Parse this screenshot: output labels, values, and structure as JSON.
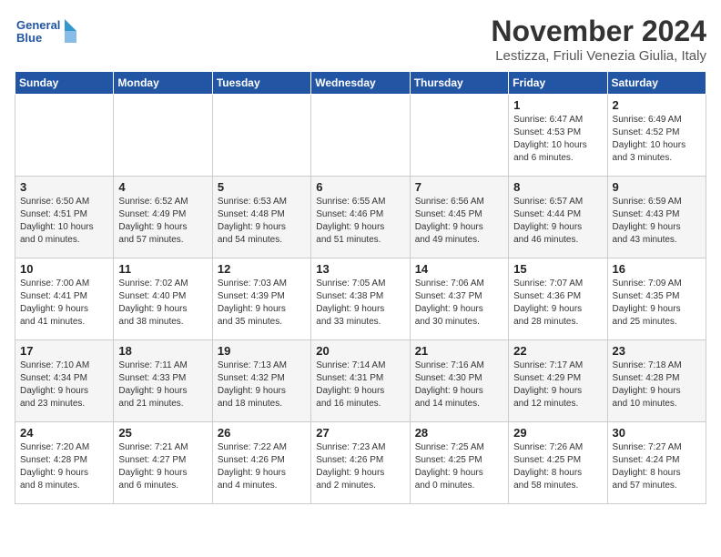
{
  "logo": {
    "text_general": "General",
    "text_blue": "Blue"
  },
  "header": {
    "month": "November 2024",
    "location": "Lestizza, Friuli Venezia Giulia, Italy"
  },
  "weekdays": [
    "Sunday",
    "Monday",
    "Tuesday",
    "Wednesday",
    "Thursday",
    "Friday",
    "Saturday"
  ],
  "weeks": [
    [
      {
        "day": "",
        "info": ""
      },
      {
        "day": "",
        "info": ""
      },
      {
        "day": "",
        "info": ""
      },
      {
        "day": "",
        "info": ""
      },
      {
        "day": "",
        "info": ""
      },
      {
        "day": "1",
        "info": "Sunrise: 6:47 AM\nSunset: 4:53 PM\nDaylight: 10 hours\nand 6 minutes."
      },
      {
        "day": "2",
        "info": "Sunrise: 6:49 AM\nSunset: 4:52 PM\nDaylight: 10 hours\nand 3 minutes."
      }
    ],
    [
      {
        "day": "3",
        "info": "Sunrise: 6:50 AM\nSunset: 4:51 PM\nDaylight: 10 hours\nand 0 minutes."
      },
      {
        "day": "4",
        "info": "Sunrise: 6:52 AM\nSunset: 4:49 PM\nDaylight: 9 hours\nand 57 minutes."
      },
      {
        "day": "5",
        "info": "Sunrise: 6:53 AM\nSunset: 4:48 PM\nDaylight: 9 hours\nand 54 minutes."
      },
      {
        "day": "6",
        "info": "Sunrise: 6:55 AM\nSunset: 4:46 PM\nDaylight: 9 hours\nand 51 minutes."
      },
      {
        "day": "7",
        "info": "Sunrise: 6:56 AM\nSunset: 4:45 PM\nDaylight: 9 hours\nand 49 minutes."
      },
      {
        "day": "8",
        "info": "Sunrise: 6:57 AM\nSunset: 4:44 PM\nDaylight: 9 hours\nand 46 minutes."
      },
      {
        "day": "9",
        "info": "Sunrise: 6:59 AM\nSunset: 4:43 PM\nDaylight: 9 hours\nand 43 minutes."
      }
    ],
    [
      {
        "day": "10",
        "info": "Sunrise: 7:00 AM\nSunset: 4:41 PM\nDaylight: 9 hours\nand 41 minutes."
      },
      {
        "day": "11",
        "info": "Sunrise: 7:02 AM\nSunset: 4:40 PM\nDaylight: 9 hours\nand 38 minutes."
      },
      {
        "day": "12",
        "info": "Sunrise: 7:03 AM\nSunset: 4:39 PM\nDaylight: 9 hours\nand 35 minutes."
      },
      {
        "day": "13",
        "info": "Sunrise: 7:05 AM\nSunset: 4:38 PM\nDaylight: 9 hours\nand 33 minutes."
      },
      {
        "day": "14",
        "info": "Sunrise: 7:06 AM\nSunset: 4:37 PM\nDaylight: 9 hours\nand 30 minutes."
      },
      {
        "day": "15",
        "info": "Sunrise: 7:07 AM\nSunset: 4:36 PM\nDaylight: 9 hours\nand 28 minutes."
      },
      {
        "day": "16",
        "info": "Sunrise: 7:09 AM\nSunset: 4:35 PM\nDaylight: 9 hours\nand 25 minutes."
      }
    ],
    [
      {
        "day": "17",
        "info": "Sunrise: 7:10 AM\nSunset: 4:34 PM\nDaylight: 9 hours\nand 23 minutes."
      },
      {
        "day": "18",
        "info": "Sunrise: 7:11 AM\nSunset: 4:33 PM\nDaylight: 9 hours\nand 21 minutes."
      },
      {
        "day": "19",
        "info": "Sunrise: 7:13 AM\nSunset: 4:32 PM\nDaylight: 9 hours\nand 18 minutes."
      },
      {
        "day": "20",
        "info": "Sunrise: 7:14 AM\nSunset: 4:31 PM\nDaylight: 9 hours\nand 16 minutes."
      },
      {
        "day": "21",
        "info": "Sunrise: 7:16 AM\nSunset: 4:30 PM\nDaylight: 9 hours\nand 14 minutes."
      },
      {
        "day": "22",
        "info": "Sunrise: 7:17 AM\nSunset: 4:29 PM\nDaylight: 9 hours\nand 12 minutes."
      },
      {
        "day": "23",
        "info": "Sunrise: 7:18 AM\nSunset: 4:28 PM\nDaylight: 9 hours\nand 10 minutes."
      }
    ],
    [
      {
        "day": "24",
        "info": "Sunrise: 7:20 AM\nSunset: 4:28 PM\nDaylight: 9 hours\nand 8 minutes."
      },
      {
        "day": "25",
        "info": "Sunrise: 7:21 AM\nSunset: 4:27 PM\nDaylight: 9 hours\nand 6 minutes."
      },
      {
        "day": "26",
        "info": "Sunrise: 7:22 AM\nSunset: 4:26 PM\nDaylight: 9 hours\nand 4 minutes."
      },
      {
        "day": "27",
        "info": "Sunrise: 7:23 AM\nSunset: 4:26 PM\nDaylight: 9 hours\nand 2 minutes."
      },
      {
        "day": "28",
        "info": "Sunrise: 7:25 AM\nSunset: 4:25 PM\nDaylight: 9 hours\nand 0 minutes."
      },
      {
        "day": "29",
        "info": "Sunrise: 7:26 AM\nSunset: 4:25 PM\nDaylight: 8 hours\nand 58 minutes."
      },
      {
        "day": "30",
        "info": "Sunrise: 7:27 AM\nSunset: 4:24 PM\nDaylight: 8 hours\nand 57 minutes."
      }
    ]
  ]
}
